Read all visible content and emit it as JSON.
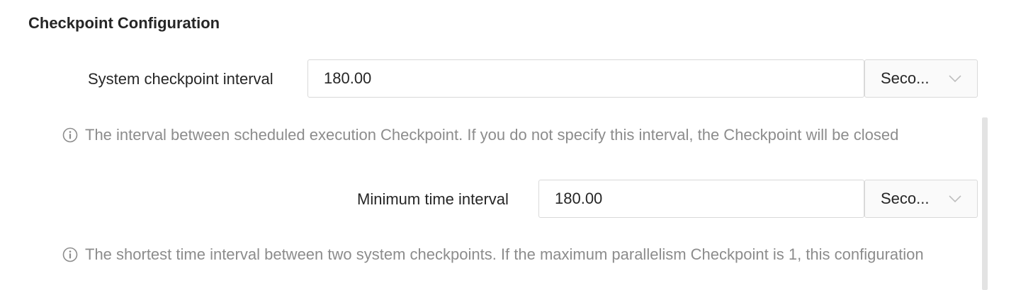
{
  "section": {
    "title": "Checkpoint Configuration"
  },
  "system_checkpoint": {
    "label": "System checkpoint interval",
    "value": "180.00",
    "unit": "Seco...",
    "help": "The interval between scheduled execution Checkpoint. If you do not specify this interval, the Checkpoint will be closed"
  },
  "minimum_interval": {
    "label": "Minimum time interval",
    "value": "180.00",
    "unit": "Seco...",
    "help": "The shortest time interval between two system checkpoints. If the maximum parallelism Checkpoint is 1, this configuration"
  },
  "icons": {
    "info": "info-circle-icon",
    "dropdown": "chevron-down-icon"
  },
  "colors": {
    "text": "#262626",
    "help_text": "#8c8c8c",
    "border": "#d9d9d9",
    "select_bg": "#fafafa",
    "scrollbar": "#e3e3e3"
  }
}
